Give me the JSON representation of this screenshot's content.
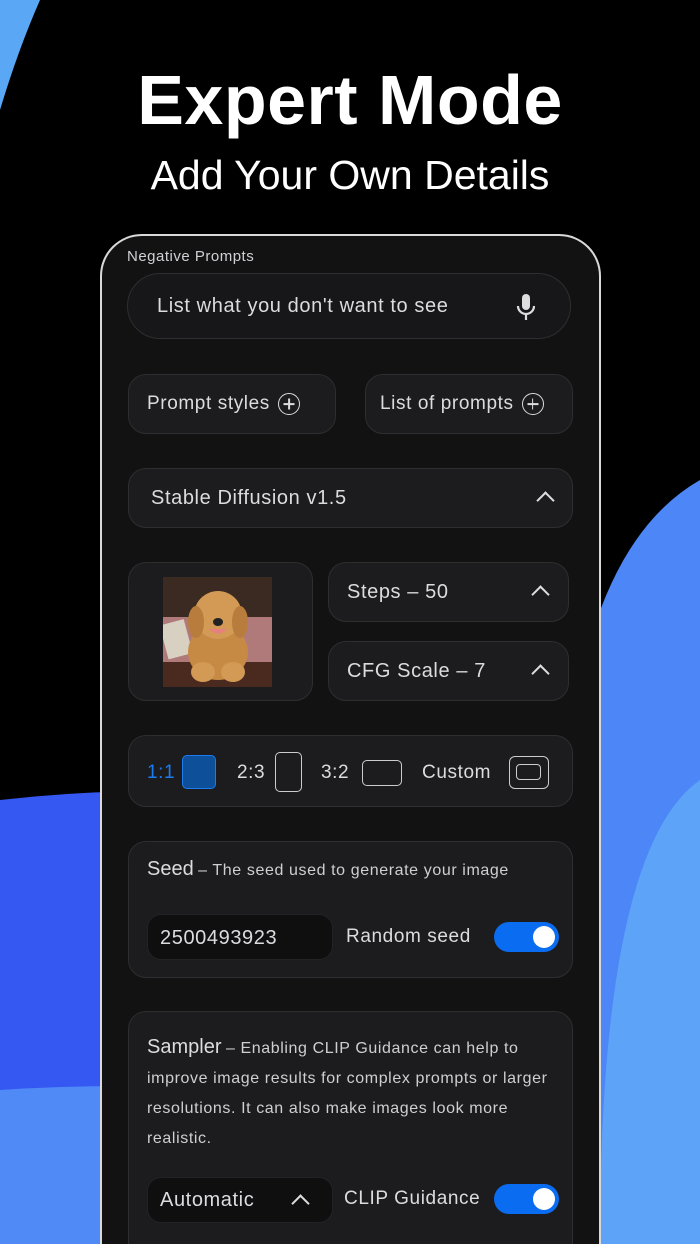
{
  "hero": {
    "title": "Expert Mode",
    "subtitle": "Add Your Own Details"
  },
  "negative_prompts": {
    "label": "Negative Prompts",
    "placeholder": "List what you don't want to see"
  },
  "buttons": {
    "prompt_styles": "Prompt styles",
    "list_of_prompts": "List of prompts"
  },
  "model": {
    "selected": "Stable Diffusion v1.5"
  },
  "steps": {
    "label": "Steps – 50",
    "value": 50
  },
  "cfg": {
    "label": "CFG Scale – 7",
    "value": 7
  },
  "aspect": {
    "options": [
      "1:1",
      "2:3",
      "3:2",
      "Custom"
    ],
    "selected": "1:1"
  },
  "seed": {
    "title": "Seed",
    "description": "– The seed used to generate your image",
    "value": "2500493923",
    "random_label": "Random seed",
    "random_on": true
  },
  "sampler": {
    "title": "Sampler",
    "description": "– Enabling CLIP Guidance can help to improve image results for complex prompts or larger resolutions. It can also make images look more realistic.",
    "selected": "Automatic",
    "clip_label": "CLIP Guidance",
    "clip_on": true
  },
  "colors": {
    "accent": "#0a6cf0",
    "background": "#000000",
    "panel": "#1c1c1e"
  }
}
